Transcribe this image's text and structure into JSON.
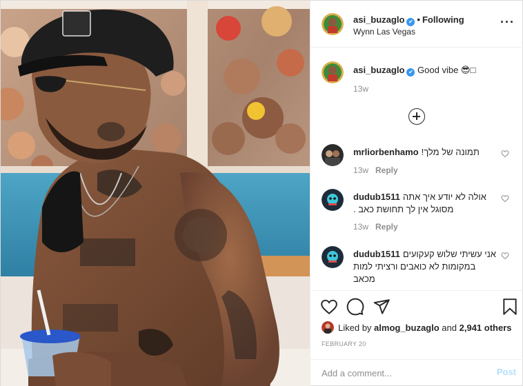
{
  "header": {
    "username": "asi_buzaglo",
    "separator": "•",
    "follow_label": "Following",
    "location": "Wynn Las Vegas",
    "more_icon": "more-horizontal-icon",
    "verified_icon": "verified-badge-icon"
  },
  "caption": {
    "username": "asi_buzaglo",
    "text": "Good vibe 😎□",
    "time": "13w"
  },
  "load_more_icon": "plus-circle-icon",
  "comments": [
    {
      "username": "mrliorbenhamo",
      "text": "תמונה של מלך!",
      "time": "13w",
      "reply_label": "Reply"
    },
    {
      "username": "dudub1511",
      "text": "אולה לא יודע איך אתה מסוגל אין לך תחושת כאב .",
      "time": "13w",
      "reply_label": "Reply"
    },
    {
      "username": "dudub1511",
      "text": "אני עשיתי שלוש קעקועים במקומות לא כואבים ורציתי למות מכאב",
      "time": "",
      "reply_label": ""
    }
  ],
  "actions": {
    "like_icon": "heart-icon",
    "comment_icon": "comment-icon",
    "share_icon": "send-icon",
    "save_icon": "bookmark-icon"
  },
  "likes": {
    "prefix": "Liked by",
    "user": "almog_buzaglo",
    "connector": "and",
    "others": "2,941 others"
  },
  "date": "FEBRUARY 20",
  "add_comment": {
    "placeholder": "Add a comment...",
    "post_label": "Post"
  },
  "colors": {
    "accent": "#3897f0",
    "post_disabled": "#b2dffc",
    "muted": "#8e8e8e",
    "text": "#262626"
  }
}
